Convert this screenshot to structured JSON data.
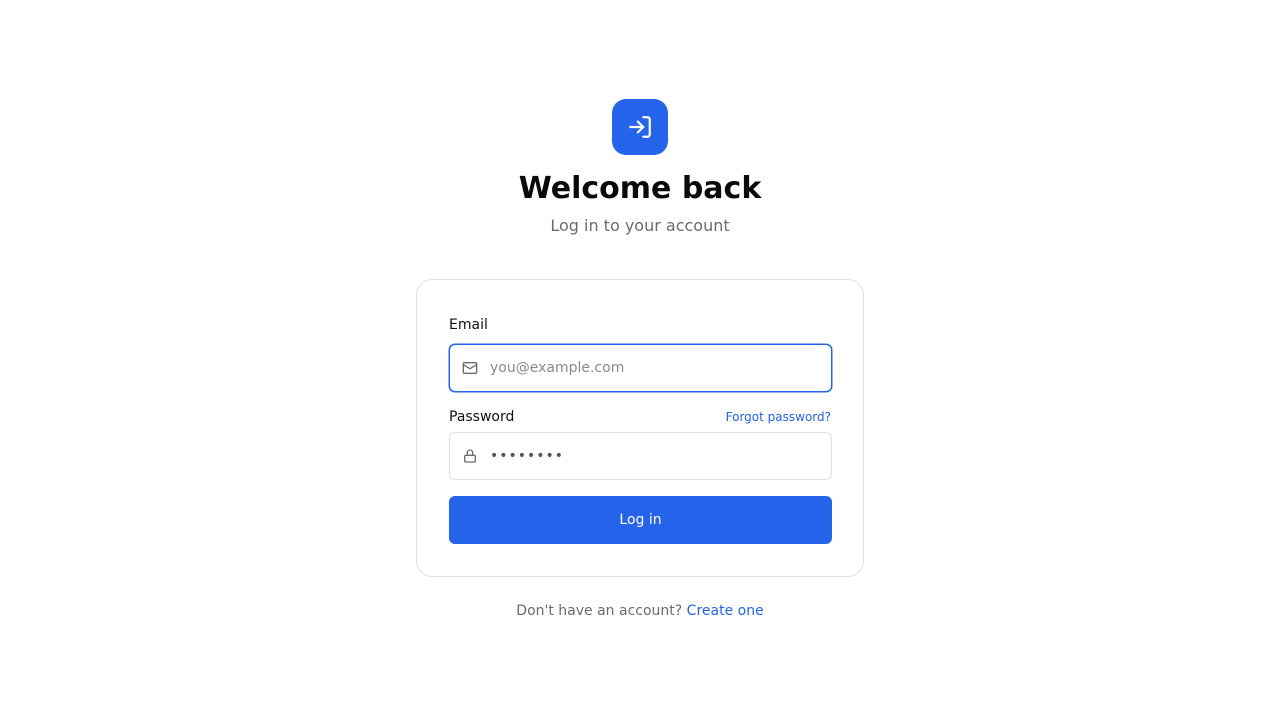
{
  "header": {
    "logo_icon": "login-icon",
    "title": "Welcome back",
    "subtitle": "Log in to your account"
  },
  "form": {
    "email": {
      "label": "Email",
      "icon": "mail-icon",
      "placeholder": "you@example.com",
      "value": ""
    },
    "password": {
      "label": "Password",
      "icon": "lock-icon",
      "value": "password",
      "forgot_label": "Forgot password?"
    },
    "submit_label": "Log in"
  },
  "footer": {
    "prompt": "Don't have an account?",
    "link_label": "Create one"
  },
  "colors": {
    "accent": "#2563eb",
    "muted_text": "#6b6b6b",
    "border": "#e3e3e3"
  }
}
